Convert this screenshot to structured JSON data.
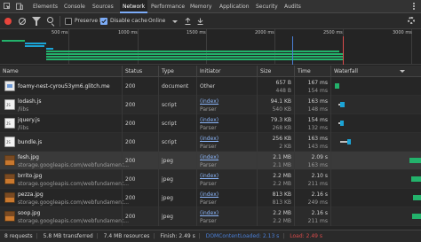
{
  "tabs": [
    "Elements",
    "Console",
    "Sources",
    "Network",
    "Performance",
    "Memory",
    "Application",
    "Security",
    "Audits"
  ],
  "active_tab": "Network",
  "toolbar": {
    "preserve_log_label": "Preserve log",
    "disable_cache_label": "Disable cache",
    "throttle_value": "Online",
    "preserve_log_checked": false,
    "disable_cache_checked": true
  },
  "overview": {
    "tick_labels": [
      "500 ms",
      "1000 ms",
      "1500 ms",
      "2000 ms",
      "2500 ms",
      "3000 ms"
    ]
  },
  "columns": [
    "Name",
    "Status",
    "Type",
    "Initiator",
    "Size",
    "Time",
    "Waterfall"
  ],
  "rows": [
    {
      "name": "foamy-nest-cyrou53ym6.glitch.me",
      "path": "",
      "status": "200",
      "type": "document",
      "initiator": "Other",
      "initiator_sub": "",
      "size": "657 B",
      "size_sub": "448 B",
      "time": "167 ms",
      "time_sub": "154 ms",
      "icon": "document-icon",
      "kind": "doc"
    },
    {
      "name": "lodash.js",
      "path": "/libs",
      "status": "200",
      "type": "script",
      "initiator": "(index)",
      "initiator_sub": "Parser",
      "size": "94.1 KB",
      "size_sub": "540 KB",
      "time": "163 ms",
      "time_sub": "148 ms",
      "icon": "script-icon",
      "kind": "js"
    },
    {
      "name": "jquery.js",
      "path": "/libs",
      "status": "200",
      "type": "script",
      "initiator": "(index)",
      "initiator_sub": "Parser",
      "size": "79.3 KB",
      "size_sub": "268 KB",
      "time": "154 ms",
      "time_sub": "132 ms",
      "icon": "script-icon",
      "kind": "js"
    },
    {
      "name": "bundle.js",
      "path": "",
      "status": "200",
      "type": "script",
      "initiator": "(index)",
      "initiator_sub": "Parser",
      "size": "256 KB",
      "size_sub": "2 KB",
      "time": "163 ms",
      "time_sub": "143 ms",
      "icon": "script-icon",
      "kind": "js"
    },
    {
      "name": "fesh.jpg",
      "path": "storage.googleapis.com/webfundament...",
      "status": "200",
      "type": "jpeg",
      "initiator": "(index)",
      "initiator_sub": "Parser",
      "size": "2.1 MB",
      "size_sub": "2.1 MB",
      "time": "2.09 s",
      "time_sub": "163 ms",
      "icon": "image-icon",
      "kind": "img"
    },
    {
      "name": "brrito.jpg",
      "path": "storage.googleapis.com/webfundament...",
      "status": "200",
      "type": "jpeg",
      "initiator": "(index)",
      "initiator_sub": "Parser",
      "size": "2.2 MB",
      "size_sub": "2.2 MB",
      "time": "2.10 s",
      "time_sub": "211 ms",
      "icon": "image-icon",
      "kind": "img"
    },
    {
      "name": "pezza.jpg",
      "path": "storage.googleapis.com/webfundament...",
      "status": "200",
      "type": "jpeg",
      "initiator": "(index)",
      "initiator_sub": "Parser",
      "size": "813 KB",
      "size_sub": "813 KB",
      "time": "2.16 s",
      "time_sub": "249 ms",
      "icon": "image-icon",
      "kind": "img"
    },
    {
      "name": "soop.jpg",
      "path": "storage.googleapis.com/webfundament...",
      "status": "200",
      "type": "jpeg",
      "initiator": "(index)",
      "initiator_sub": "Parser",
      "size": "2.2 MB",
      "size_sub": "2.2 MB",
      "time": "2.16 s",
      "time_sub": "211 ms",
      "icon": "image-icon",
      "kind": "img"
    }
  ],
  "status_bar": {
    "requests": "8 requests",
    "transferred": "5.8 MB transferred",
    "resources": "7.4 MB resources",
    "finish": "Finish: 2.49 s",
    "dom_loaded": "DOMContentLoaded: 2.13 s",
    "load": "Load: 2.49 s"
  },
  "colors": {
    "accent": "#7cacf8",
    "record": "#e8453c",
    "waterfall_doc": "#23b26b",
    "waterfall_script": "#1ba4d6",
    "waterfall_image": "#23b26b",
    "dom_loaded_line": "#4b7fd6",
    "load_line": "#d84b4b",
    "link": "#8ab4f8"
  }
}
